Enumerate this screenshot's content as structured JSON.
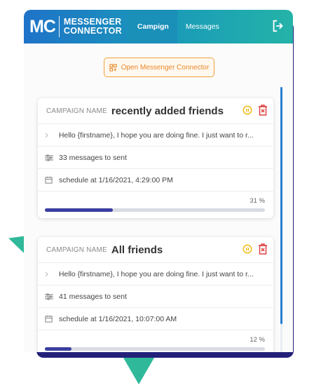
{
  "brand": {
    "mark": "MC",
    "line1": "MESSENGER",
    "line2": "CONNECTOR"
  },
  "tabs": [
    {
      "label": "Campign",
      "active": true
    },
    {
      "label": "Messages",
      "active": false
    }
  ],
  "open_button": {
    "label": "Open Messenger Connector"
  },
  "campaigns": [
    {
      "name_label": "CAMPAIGN NAME",
      "name": "recently added friends",
      "message": "Hello {firstname}, I hope you are doing fine. I just want to r...",
      "messages_count": "33 messages to sent",
      "schedule": "schedule at 1/16/2021, 4:29:00 PM",
      "progress_label": "31 %",
      "progress": 0.31
    },
    {
      "name_label": "CAMPAIGN NAME",
      "name": "All friends",
      "message": "Hello {firstname}, I hope you are doing fine. I just want to r...",
      "messages_count": "41 messages to sent",
      "schedule": "schedule at 1/16/2021, 10:07:00 AM",
      "progress_label": "12 %",
      "progress": 0.12
    }
  ],
  "colors": {
    "accent_orange": "#f0a040",
    "pause_yellow": "#f0b400",
    "delete_red": "#e04040",
    "progress": "#3b3fa0",
    "back_panel": "#23207a",
    "decor_teal": "#2fb99a"
  },
  "icons": {
    "logout": "logout-icon",
    "open": "grid-icon",
    "pause": "pause-circle-icon",
    "delete": "trash-icon",
    "message": "chevron-right-icon",
    "count": "sliders-icon",
    "schedule": "calendar-icon"
  }
}
